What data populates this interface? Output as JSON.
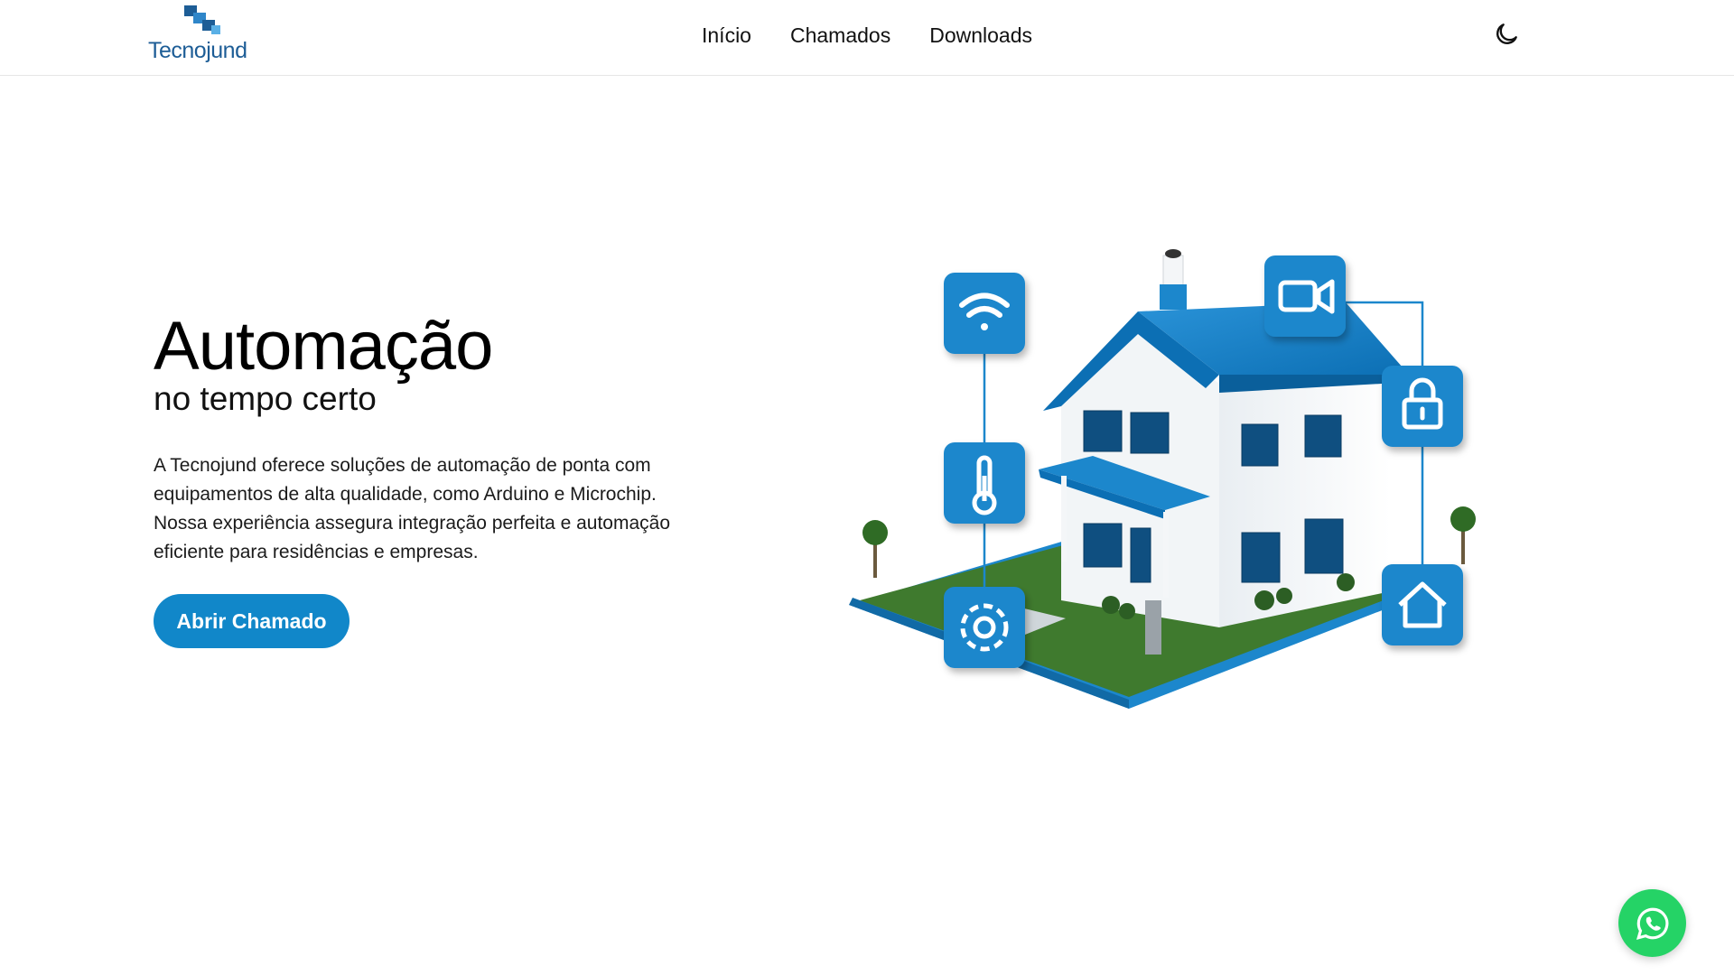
{
  "brand": {
    "name": "Tecnojund",
    "color": "#1d5d96"
  },
  "nav": [
    {
      "label": "Início"
    },
    {
      "label": "Chamados"
    },
    {
      "label": "Downloads"
    }
  ],
  "header": {
    "theme_icon": "moon-icon"
  },
  "hero": {
    "title": "Automação",
    "subtitle": "no tempo certo",
    "description": "A Tecnojund oferece soluções de automação de ponta com equipamentos de alta qualidade, como Arduino e Microchip. Nossa experiência assegura integração perfeita e automação eficiente para residências e empresas.",
    "cta_label": "Abrir Chamado"
  },
  "illustration": {
    "icons": [
      "wifi-icon",
      "video-camera-icon",
      "lock-icon",
      "thermometer-icon",
      "home-icon",
      "gear-icon"
    ],
    "accent": "#1187c9"
  },
  "floating": {
    "icon": "whatsapp-icon",
    "color": "#25d366"
  },
  "colors": {
    "accent": "#1187c9",
    "text": "#111111",
    "background": "#ffffff"
  }
}
